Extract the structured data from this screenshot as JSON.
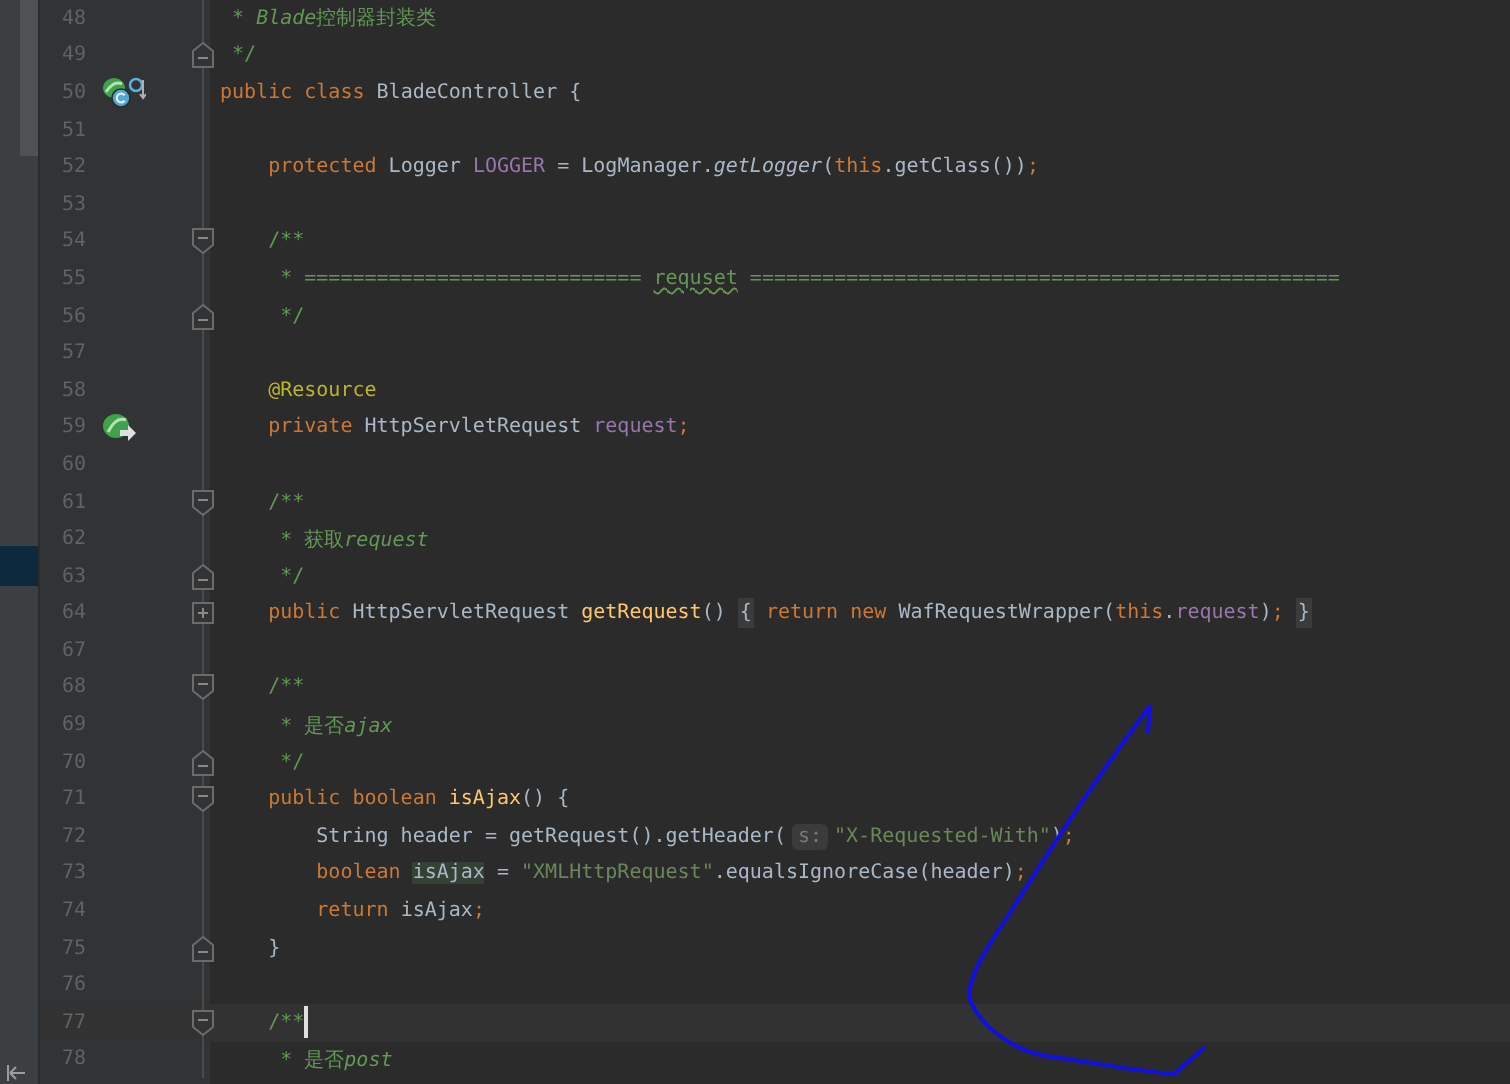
{
  "editor": {
    "lines": [
      {
        "number": "48",
        "current": false,
        "tokens": [
          {
            "kind": "doc",
            "text": " * "
          },
          {
            "kind": "doc-italic",
            "text": "Blade"
          },
          {
            "kind": "doc",
            "text": "控制器封装类"
          }
        ]
      },
      {
        "number": "49",
        "fold_end": true,
        "current": false,
        "tokens": [
          {
            "kind": "doc",
            "text": " */"
          }
        ]
      },
      {
        "number": "50",
        "class_bean_marker": true,
        "current": false,
        "tokens": [
          {
            "kind": "keyword",
            "text": "public class "
          },
          {
            "kind": "plain",
            "text": "BladeController {"
          }
        ]
      },
      {
        "number": "51",
        "current": false
      },
      {
        "number": "52",
        "current": false,
        "tokens": [
          {
            "kind": "keyword",
            "text": "    protected "
          },
          {
            "kind": "plain",
            "text": "Logger "
          },
          {
            "kind": "field",
            "text": "LOGGER"
          },
          {
            "kind": "plain",
            "text": " = LogManager."
          },
          {
            "kind": "static",
            "text": "getLogger"
          },
          {
            "kind": "plain",
            "text": "("
          },
          {
            "kind": "keyword",
            "text": "this"
          },
          {
            "kind": "plain",
            "text": ".getClass())"
          },
          {
            "kind": "keyword",
            "text": ";"
          }
        ]
      },
      {
        "number": "53",
        "current": false
      },
      {
        "number": "54",
        "fold_start": true,
        "current": false,
        "tokens": [
          {
            "kind": "doc",
            "text": "    /**"
          }
        ]
      },
      {
        "number": "55",
        "current": false,
        "tokens": [
          {
            "kind": "doc",
            "text": "     * ============================ "
          },
          {
            "kind": "typo",
            "text": "requset"
          },
          {
            "kind": "doc",
            "text": " ================================================="
          }
        ]
      },
      {
        "number": "56",
        "fold_end": true,
        "current": false,
        "tokens": [
          {
            "kind": "doc",
            "text": "     */"
          }
        ]
      },
      {
        "number": "57",
        "current": false
      },
      {
        "number": "58",
        "current": false,
        "tokens": [
          {
            "kind": "annotation",
            "text": "    @Resource"
          }
        ]
      },
      {
        "number": "59",
        "injection_marker": true,
        "current": false,
        "tokens": [
          {
            "kind": "keyword",
            "text": "    private "
          },
          {
            "kind": "plain",
            "text": "HttpServletRequest "
          },
          {
            "kind": "field",
            "text": "request"
          },
          {
            "kind": "keyword",
            "text": ";"
          }
        ]
      },
      {
        "number": "60",
        "current": false
      },
      {
        "number": "61",
        "fold_start": true,
        "current": false,
        "tokens": [
          {
            "kind": "doc",
            "text": "    /**"
          }
        ]
      },
      {
        "number": "62",
        "current": false,
        "tokens": [
          {
            "kind": "doc",
            "text": "     * 获取"
          },
          {
            "kind": "doc-italic",
            "text": "request"
          }
        ]
      },
      {
        "number": "63",
        "fold_end": true,
        "current": false,
        "tokens": [
          {
            "kind": "doc",
            "text": "     */"
          }
        ]
      },
      {
        "number": "64",
        "collapsed": true,
        "current": false,
        "tokens": [
          {
            "kind": "keyword",
            "text": "    public "
          },
          {
            "kind": "plain",
            "text": "HttpServletRequest "
          },
          {
            "kind": "method",
            "text": "getRequest"
          },
          {
            "kind": "plain",
            "text": "() "
          },
          {
            "kind": "folded",
            "text": "{"
          },
          {
            "kind": "keyword",
            "text": " return new "
          },
          {
            "kind": "plain",
            "text": "WafRequestWrapper("
          },
          {
            "kind": "keyword",
            "text": "this"
          },
          {
            "kind": "plain",
            "text": "."
          },
          {
            "kind": "field",
            "text": "request"
          },
          {
            "kind": "plain",
            "text": ")"
          },
          {
            "kind": "keyword",
            "text": "; "
          },
          {
            "kind": "folded",
            "text": "}"
          }
        ]
      },
      {
        "number": "67",
        "current": false
      },
      {
        "number": "68",
        "fold_start": true,
        "current": false,
        "tokens": [
          {
            "kind": "doc",
            "text": "    /**"
          }
        ]
      },
      {
        "number": "69",
        "current": false,
        "tokens": [
          {
            "kind": "doc",
            "text": "     * 是否"
          },
          {
            "kind": "doc-italic",
            "text": "ajax"
          }
        ]
      },
      {
        "number": "70",
        "fold_end": true,
        "current": false,
        "tokens": [
          {
            "kind": "doc",
            "text": "     */"
          }
        ]
      },
      {
        "number": "71",
        "fold_start": true,
        "current": false,
        "tokens": [
          {
            "kind": "keyword",
            "text": "    public boolean "
          },
          {
            "kind": "method",
            "text": "isAjax"
          },
          {
            "kind": "plain",
            "text": "() {"
          }
        ]
      },
      {
        "number": "72",
        "current": false,
        "tokens": [
          {
            "kind": "plain",
            "text": "        String header = getRequest().getHeader("
          },
          {
            "kind": "hint",
            "text": "s:"
          },
          {
            "kind": "string",
            "text": "\"X-Requested-With\""
          },
          {
            "kind": "plain",
            "text": ")"
          },
          {
            "kind": "keyword",
            "text": ";"
          }
        ]
      },
      {
        "number": "73",
        "current": false,
        "tokens": [
          {
            "kind": "keyword",
            "text": "        boolean "
          },
          {
            "kind": "usage",
            "text": "isAjax"
          },
          {
            "kind": "plain",
            "text": " = "
          },
          {
            "kind": "string",
            "text": "\"XMLHttpRequest\""
          },
          {
            "kind": "plain",
            "text": ".equalsIgnoreCase(header)"
          },
          {
            "kind": "keyword",
            "text": ";"
          }
        ]
      },
      {
        "number": "74",
        "current": false,
        "tokens": [
          {
            "kind": "keyword",
            "text": "        return "
          },
          {
            "kind": "plain",
            "text": "isAjax"
          },
          {
            "kind": "keyword",
            "text": ";"
          }
        ]
      },
      {
        "number": "75",
        "fold_end": true,
        "current": false,
        "tokens": [
          {
            "kind": "plain",
            "text": "    }"
          }
        ]
      },
      {
        "number": "76",
        "current": false
      },
      {
        "number": "77",
        "fold_start": true,
        "current": true,
        "tokens": [
          {
            "kind": "doc",
            "text": "    /**"
          }
        ]
      },
      {
        "number": "78",
        "current": false,
        "tokens": [
          {
            "kind": "doc",
            "text": "     * 是否"
          },
          {
            "kind": "doc-italic",
            "text": "post"
          }
        ]
      }
    ]
  }
}
